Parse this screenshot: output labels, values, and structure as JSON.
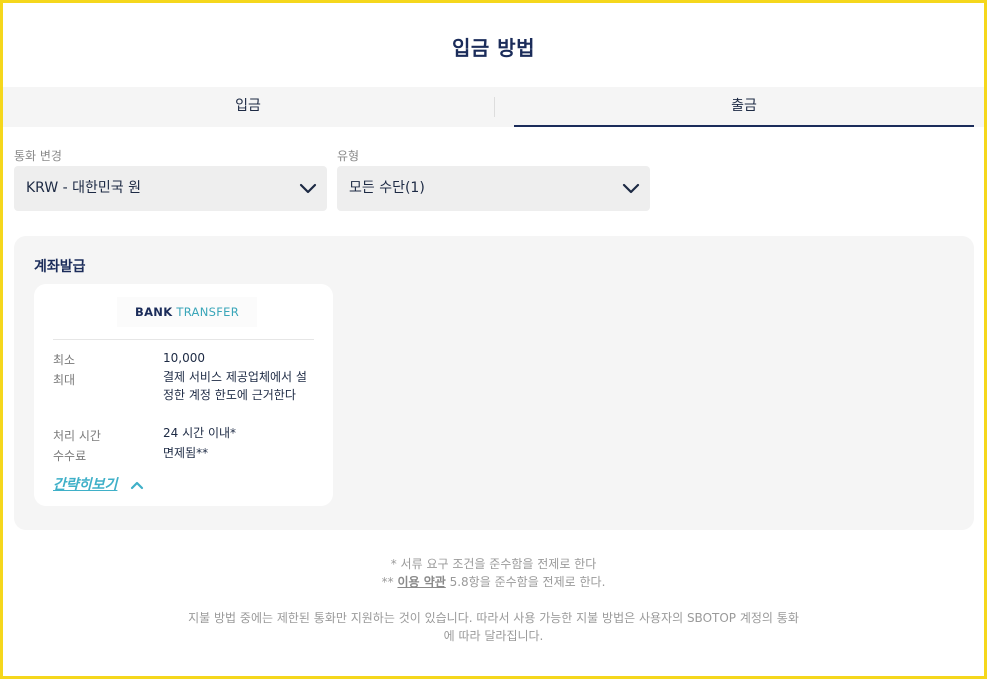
{
  "page": {
    "title": "입금 방법"
  },
  "tabs": [
    {
      "label": "입금"
    },
    {
      "label": "출금",
      "active": true
    }
  ],
  "filters": {
    "currency": {
      "label": "통화 변경",
      "value": "KRW - 대한민국 원",
      "icon": "chevron-down-icon"
    },
    "type": {
      "label": "유형",
      "value": "모든 수단(1)",
      "icon": "chevron-down-icon"
    }
  },
  "section": {
    "title": "계좌발급",
    "card": {
      "logo": {
        "word1": "BANK",
        "word2": "TRANSFER"
      },
      "rows": [
        {
          "label": "최소",
          "value": "10,000"
        },
        {
          "label": "최대",
          "value": "결제 서비스 제공업체에서 설정한 계정 한도에 근거한다"
        },
        {
          "label": "처리 시간",
          "value": "24 시간 이내*"
        },
        {
          "label": "수수료",
          "value": "면제됨**"
        }
      ],
      "collapse_label": "간략히보기",
      "collapse_icon": "chevron-up-icon"
    }
  },
  "notes": {
    "line1": "* 서류 요구 조건을 준수함을 전제로 한다",
    "line2_prefix": "** ",
    "line2_link": "이용 약관",
    "line2_suffix": " 5.8항을 준수함을 전제로 한다.",
    "line3": "지불 방법 중에는 제한된 통화만 지원하는 것이 있습니다. 따라서 사용 가능한 지불 방법은 사용자의 SBOTOP 계정의 통화",
    "line4": "에 따라 달라집니다."
  },
  "colors": {
    "frame": "#f5d71c",
    "primary": "#1b2c5a",
    "accent": "#3fb0c8"
  }
}
